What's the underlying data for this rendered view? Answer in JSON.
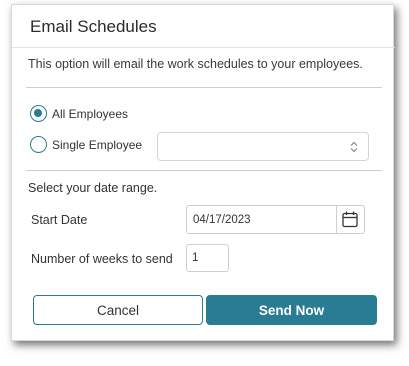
{
  "dialog": {
    "title": "Email Schedules",
    "description": "This option will email the work schedules to your employees."
  },
  "recipients": {
    "all_label": "All Employees",
    "all_checked": true,
    "single_label": "Single Employee",
    "single_checked": false,
    "employee_select_value": ""
  },
  "date_range": {
    "prompt": "Select your date range.",
    "start_date_label": "Start Date",
    "start_date_value": "04/17/2023",
    "weeks_label": "Number of weeks to send",
    "weeks_value": "1"
  },
  "buttons": {
    "cancel_label": "Cancel",
    "send_label": "Send Now"
  },
  "colors": {
    "accent": "#2a7c93",
    "text": "#333333",
    "border": "#cfcfcf"
  },
  "icons": {
    "calendar": "calendar-icon",
    "select_chevron": "chevron-updown-icon"
  }
}
